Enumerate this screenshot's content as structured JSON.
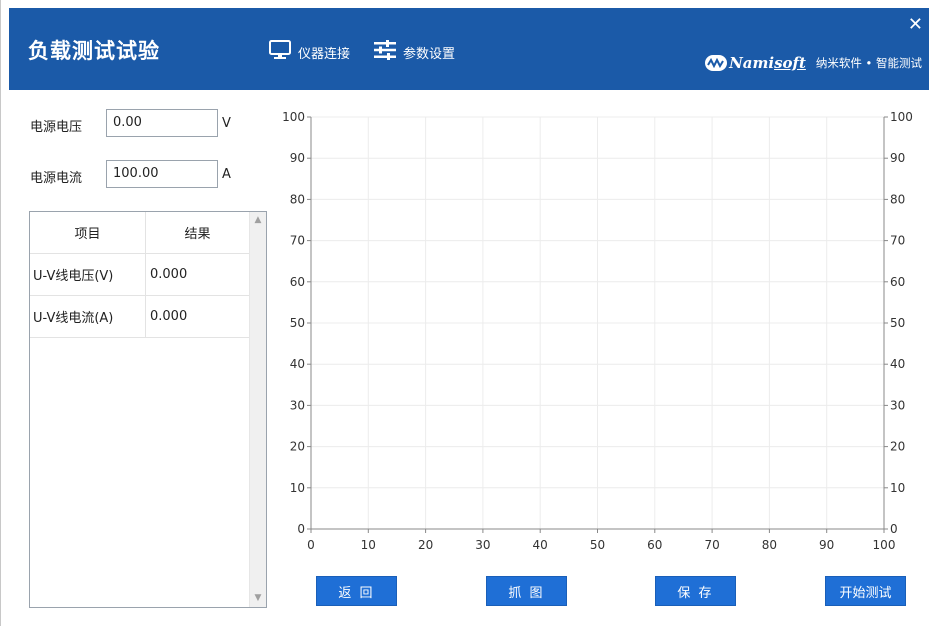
{
  "app": {
    "title": "负载测试试验"
  },
  "toolbar": {
    "connect_label": "仪器连接",
    "settings_label": "参数设置"
  },
  "brand": {
    "logo_prefix": "Nami",
    "logo_suffix": "soft",
    "tagline": "纳米软件 • 智能测试"
  },
  "form": {
    "voltage": {
      "label": "电源电压",
      "value": "0.00",
      "unit": "V"
    },
    "current": {
      "label": "电源电流",
      "value": "100.00",
      "unit": "A"
    }
  },
  "results": {
    "headers": [
      "项目",
      "结果"
    ],
    "rows": [
      [
        "U-V线电压(V)",
        "0.000"
      ],
      [
        "U-V线电流(A)",
        "0.000"
      ]
    ]
  },
  "chart_data": {
    "type": "line",
    "x": [],
    "series": [],
    "xlim": [
      0,
      100
    ],
    "ylim": [
      0,
      100
    ],
    "y2lim": [
      0,
      100
    ],
    "xticks": [
      0,
      10,
      20,
      30,
      40,
      50,
      60,
      70,
      80,
      90,
      100
    ],
    "yticks": [
      0,
      10,
      20,
      30,
      40,
      50,
      60,
      70,
      80,
      90,
      100
    ],
    "grid": true
  },
  "actions": {
    "back_label": "返 回",
    "capture_label": "抓 图",
    "save_label": "保 存",
    "start_label": "开始测试"
  }
}
